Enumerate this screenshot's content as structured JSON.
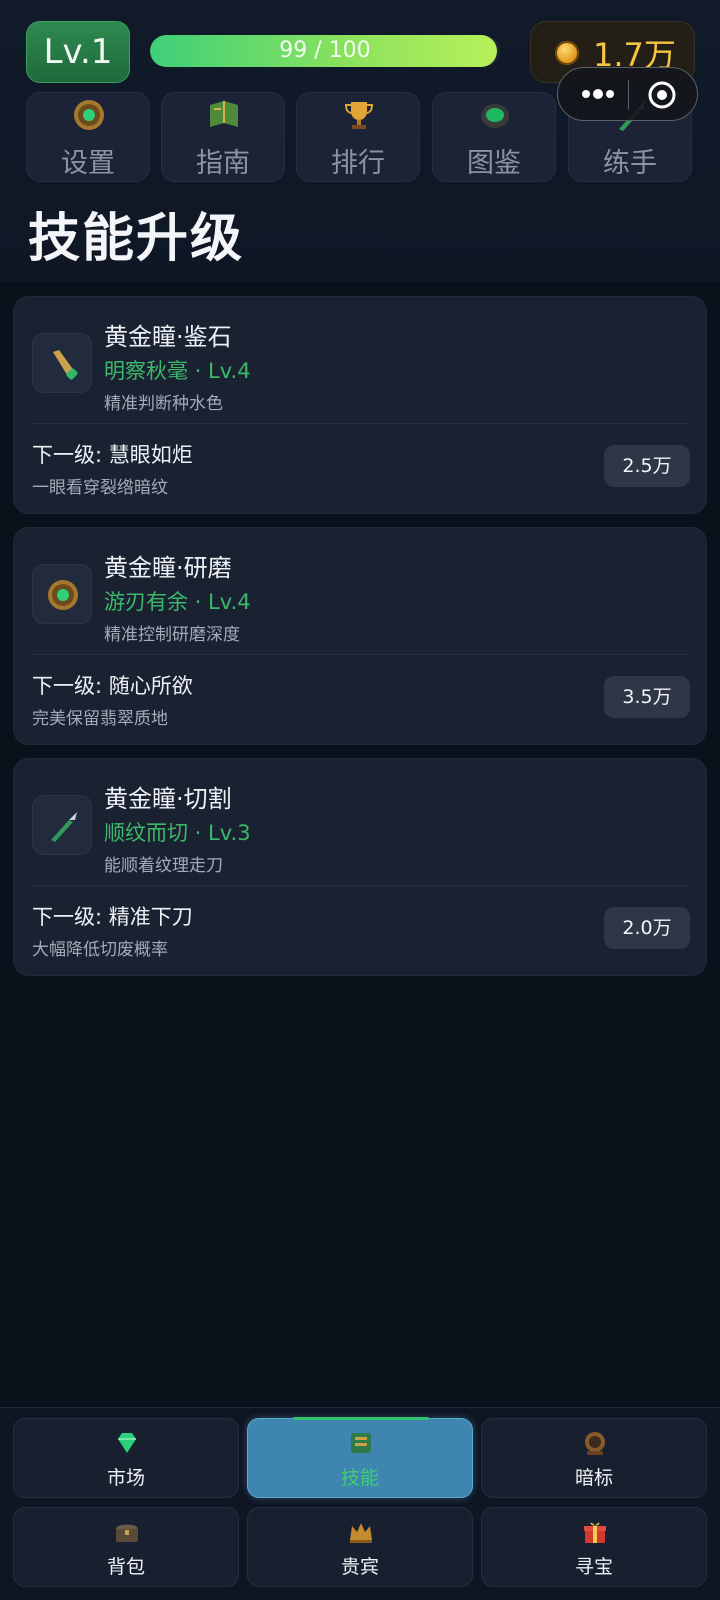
{
  "header": {
    "level": "Lv.1",
    "xp_text": "99 / 100",
    "xp_progress": 0.99,
    "coins": "1.7万"
  },
  "menu": [
    {
      "label": "设置",
      "icon": "emerald-amulet-icon"
    },
    {
      "label": "指南",
      "icon": "book-icon"
    },
    {
      "label": "排行",
      "icon": "trophy-icon"
    },
    {
      "label": "图鉴",
      "icon": "jade-stone-icon"
    },
    {
      "label": "练手",
      "icon": "carving-knife-icon"
    }
  ],
  "page_title": "技能升级",
  "skills": [
    {
      "name": "黄金瞳·鉴石",
      "sub": "明察秋毫 · Lv.4",
      "desc": "精准判断种水色",
      "next": "下一级: 慧眼如炬",
      "next_desc": "一眼看穿裂绺暗纹",
      "price": "2.5万",
      "icon": "flashlight-icon"
    },
    {
      "name": "黄金瞳·研磨",
      "sub": "游刃有余 · Lv.4",
      "desc": "精准控制研磨深度",
      "next": "下一级: 随心所欲",
      "next_desc": "完美保留翡翠质地",
      "price": "3.5万",
      "icon": "emerald-amulet-icon"
    },
    {
      "name": "黄金瞳·切割",
      "sub": "顺纹而切 · Lv.3",
      "desc": "能顺着纹理走刀",
      "next": "下一级: 精准下刀",
      "next_desc": "大幅降低切废概率",
      "price": "2.0万",
      "icon": "carving-knife-icon"
    }
  ],
  "bottom_nav": [
    {
      "label": "市场",
      "icon": "gem-icon",
      "active": false
    },
    {
      "label": "技能",
      "icon": "jade-book-icon",
      "active": true
    },
    {
      "label": "暗标",
      "icon": "auction-icon",
      "active": false
    },
    {
      "label": "背包",
      "icon": "chest-icon",
      "active": false
    },
    {
      "label": "贵宾",
      "icon": "crown-icon",
      "active": false
    },
    {
      "label": "寻宝",
      "icon": "gift-icon",
      "active": false
    }
  ],
  "colors": {
    "accent_green": "#3cb86a",
    "coin_gold": "#f4c543",
    "active_tab": "#3e86b0"
  }
}
